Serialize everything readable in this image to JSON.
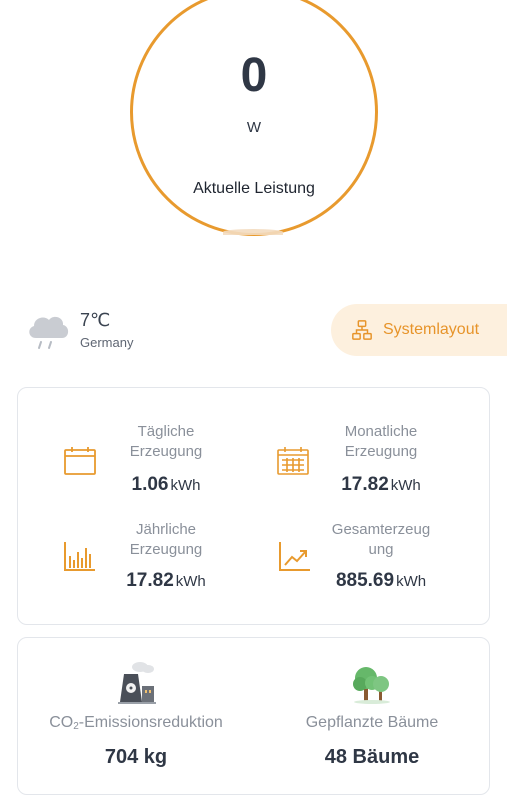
{
  "gauge": {
    "value": "0",
    "unit": "W",
    "label": "Aktuelle Leistung"
  },
  "weather": {
    "icon": "rain-cloud-icon",
    "temperature": "7℃",
    "location": "Germany"
  },
  "system_layout": {
    "icon": "network-icon",
    "label": "Systemlayout"
  },
  "production": {
    "daily": {
      "icon": "calendar-day-icon",
      "title_line1": "Tägliche",
      "title_line2": "Erzeugung",
      "value": "1.06",
      "unit": "kWh"
    },
    "monthly": {
      "icon": "calendar-month-icon",
      "title_line1": "Monatliche",
      "title_line2": "Erzeugung",
      "value": "17.82",
      "unit": "kWh"
    },
    "yearly": {
      "icon": "bar-chart-icon",
      "title_line1": "Jährliche",
      "title_line2": "Erzeugung",
      "value": "17.82",
      "unit": "kWh"
    },
    "total": {
      "icon": "trend-up-icon",
      "title_line1": "Gesamterzeug",
      "title_line2": "ung",
      "value": "885.69",
      "unit": "kWh"
    }
  },
  "environment": {
    "co2": {
      "icon": "power-plant-icon",
      "title_prefix": "CO",
      "title_sub": "2",
      "title_suffix": "-Emissionsreduktion",
      "value": "704 kg"
    },
    "trees": {
      "icon": "trees-icon",
      "title": "Gepflanzte Bäume",
      "value": "48 Bäume"
    }
  },
  "colors": {
    "accent": "#e89a2e",
    "accent_bg": "#fdf0de",
    "text_dark": "#2f3745",
    "text_muted": "#8a909a"
  }
}
